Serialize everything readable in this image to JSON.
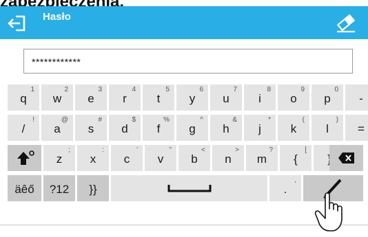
{
  "page": {
    "caption": "zabezpieczenia."
  },
  "header": {
    "title": "Hasło",
    "back_icon": "exit-arrow-icon",
    "clear_icon": "eraser-icon",
    "bg_color": "#29aee6"
  },
  "input": {
    "value": "************"
  },
  "keyboard": {
    "row1": [
      {
        "main": "q",
        "sub": "1"
      },
      {
        "main": "w",
        "sub": "2"
      },
      {
        "main": "e",
        "sub": "3"
      },
      {
        "main": "r",
        "sub": "4"
      },
      {
        "main": "t",
        "sub": "5"
      },
      {
        "main": "y",
        "sub": "6"
      },
      {
        "main": "u",
        "sub": "7"
      },
      {
        "main": "i",
        "sub": "8"
      },
      {
        "main": "o",
        "sub": "9"
      },
      {
        "main": "p",
        "sub": "0"
      },
      {
        "main": "-",
        "sub": "_"
      }
    ],
    "row2": [
      {
        "main": "/",
        "sub": "!"
      },
      {
        "main": "a",
        "sub": "@"
      },
      {
        "main": "s",
        "sub": "#"
      },
      {
        "main": "d",
        "sub": "$"
      },
      {
        "main": "f",
        "sub": "%"
      },
      {
        "main": "g",
        "sub": "^"
      },
      {
        "main": "h",
        "sub": "&"
      },
      {
        "main": "j",
        "sub": "*"
      },
      {
        "main": "k",
        "sub": "("
      },
      {
        "main": "l",
        "sub": ")"
      },
      {
        "main": "=",
        "sub": "+"
      }
    ],
    "row3": [
      {
        "main": "z",
        "sub": ";"
      },
      {
        "main": "x",
        "sub": ":"
      },
      {
        "main": "c",
        "sub": "'"
      },
      {
        "main": "v",
        "sub": "\""
      },
      {
        "main": "b",
        "sub": "<"
      },
      {
        "main": "n",
        "sub": ">"
      },
      {
        "main": "m",
        "sub": "?"
      },
      {
        "main": "{",
        "sub": "["
      },
      {
        "main": "}",
        "sub": "]"
      }
    ],
    "row4": {
      "accents": "äêő",
      "numbers": "?12",
      "symbols": "}}",
      "dot": ".",
      "dot_sub": ","
    },
    "icons": {
      "shift": "shift-arrow-icon",
      "backspace": "backspace-icon",
      "space": "space-bar-icon",
      "confirm": "pen-confirm-icon",
      "touch": "touch-hand-icon"
    }
  }
}
